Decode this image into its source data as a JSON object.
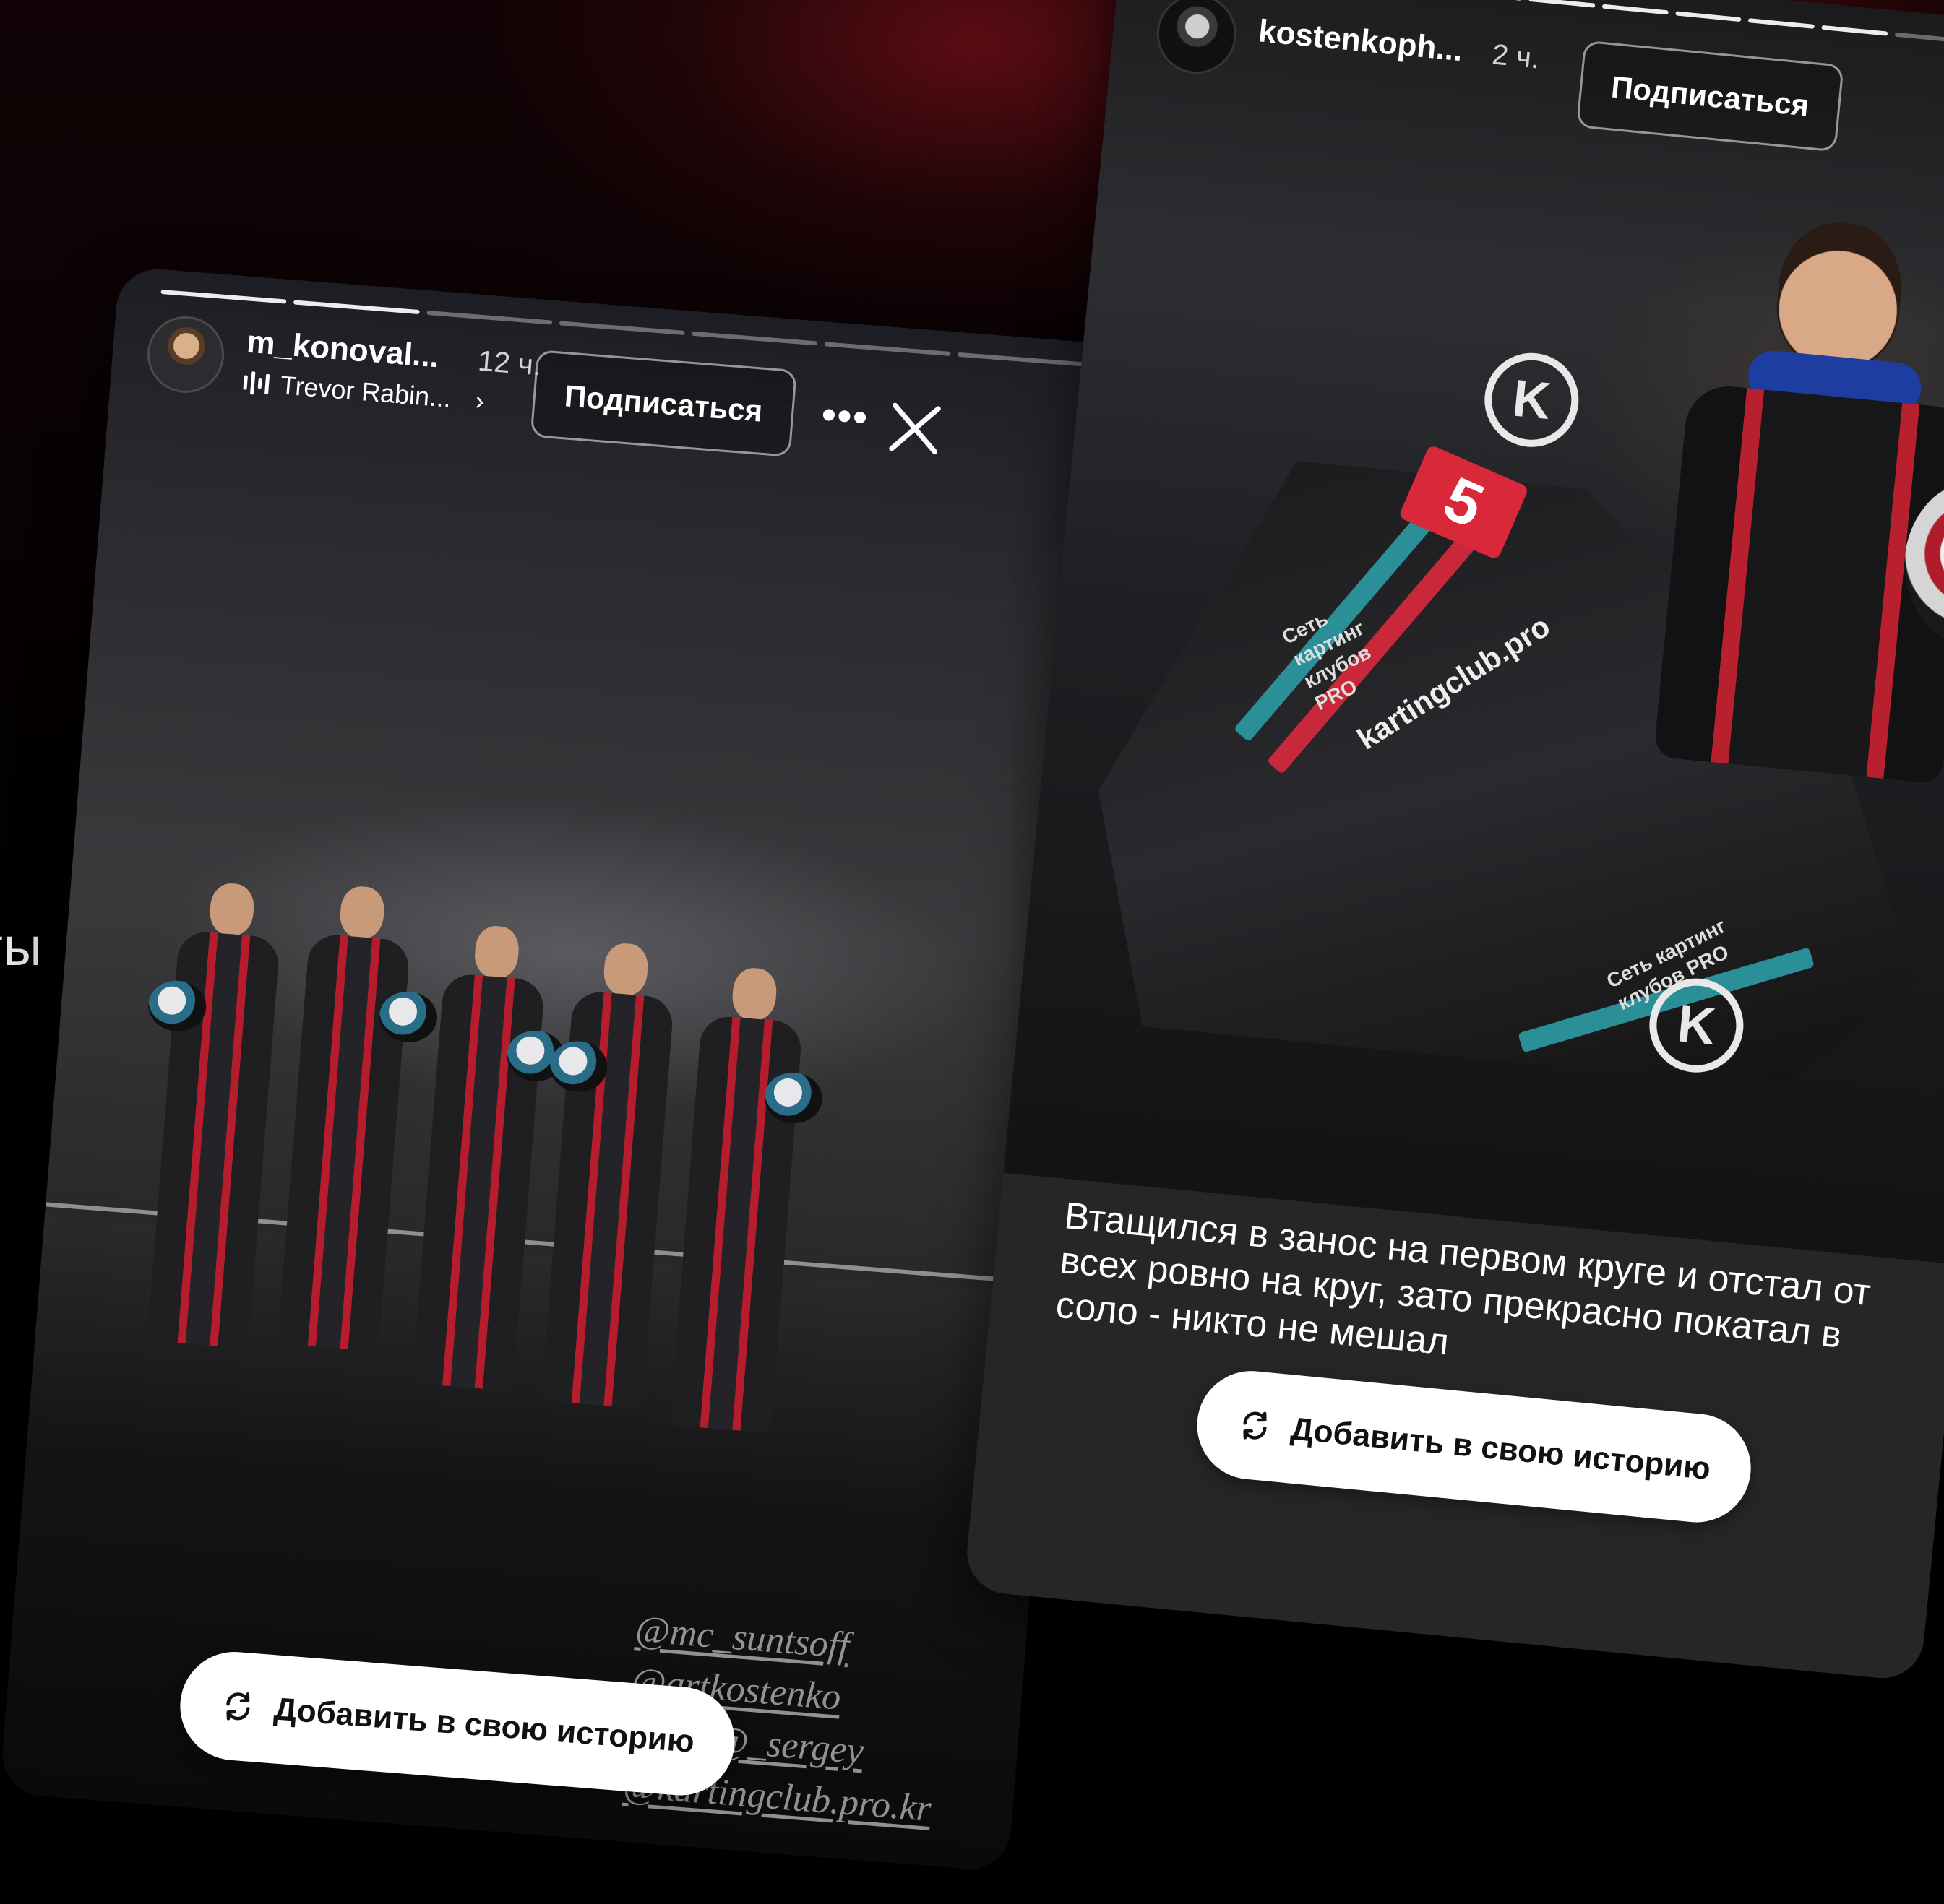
{
  "background": {
    "partial_text": "ты",
    "colors": {
      "page": "#000000",
      "accent_red": "#9a1420"
    }
  },
  "story_left": {
    "username": "m_konoval...",
    "time": "12 ч.",
    "music": {
      "icon": "music-bars-icon",
      "title": "Trevor Rabin...",
      "chevron": "›"
    },
    "follow_label": "Подписаться",
    "more_icon": "•••",
    "close_icon": "close-icon",
    "progress": {
      "segments": 7,
      "completed": 2
    },
    "mentions": [
      "@mc_suntsoff",
      "@artkostenko",
      "@_sergey",
      "@kartingclub.pro.kr"
    ],
    "add_story_label": "Добавить в свою историю"
  },
  "story_right": {
    "username": "kostenkoph...",
    "time": "2 ч.",
    "follow_label": "Подписаться",
    "progress": {
      "segments": 12,
      "completed": 10
    },
    "kart": {
      "number": "5",
      "brand_url": "kartingclub.pro",
      "side_text": "Сеть картинг клубов PRO",
      "logo_letter": "K"
    },
    "caption": "Втащился в занос на первом круге и отстал от всех ровно на круг, зато прекрасно покатал в соло - никто не мешал",
    "add_story_label": "Добавить в свою историю"
  }
}
